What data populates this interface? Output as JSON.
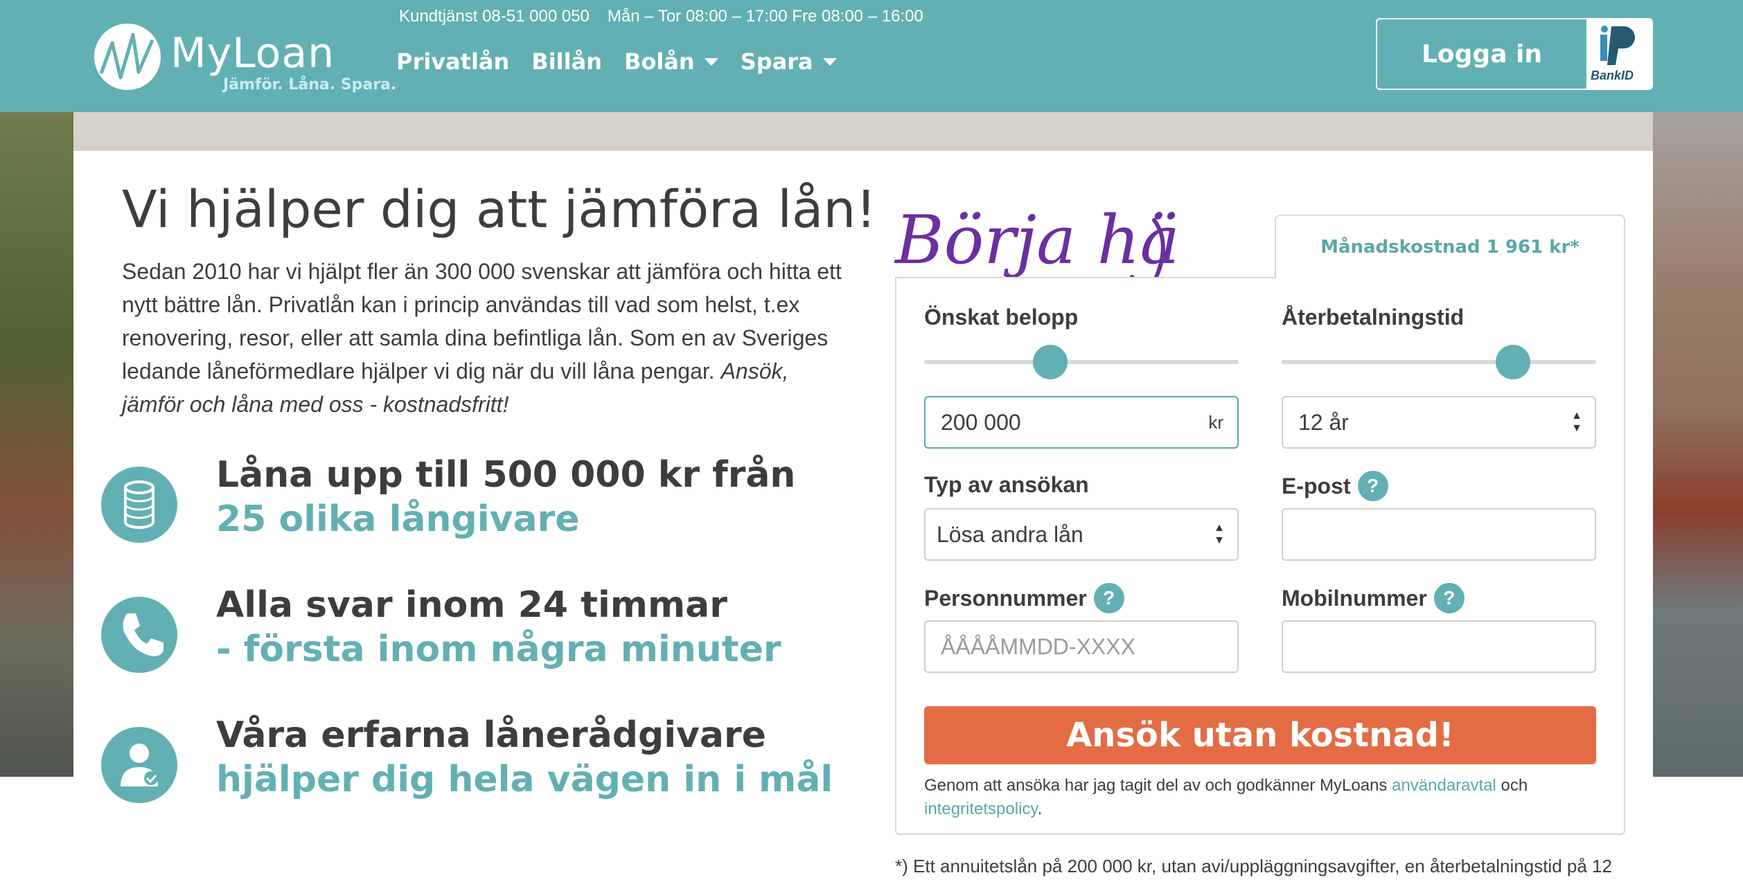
{
  "header": {
    "brand": "MyLoan",
    "tagline": "Jämför. Låna. Spara.",
    "support_phone": "Kundtjänst 08-51 000 050",
    "support_hours": "Mån – Tor 08:00 – 17:00 Fre 08:00 – 16:00",
    "nav": [
      {
        "label": "Privatlån",
        "dropdown": false
      },
      {
        "label": "Billån",
        "dropdown": false
      },
      {
        "label": "Bolån",
        "dropdown": true
      },
      {
        "label": "Spara",
        "dropdown": true
      }
    ],
    "login_label": "Logga in",
    "bankid_label": "BankID"
  },
  "hero": {
    "title": "Vi hjälper dig att jämföra lån!",
    "text": "Sedan 2010 har vi hjälpt fler än 300 000 svenskar att jämföra och hitta ett nytt bättre lån. Privatlån kan i princip användas till vad som helst, t.ex renovering, resor, eller att samla dina befintliga lån. Som en av Sveriges ledande låneförmedlare hjälper vi dig när du vill låna pengar.",
    "text_emphasis": "Ansök, jämför och låna med oss - kostnadsfritt!"
  },
  "features": [
    {
      "icon": "coins-icon",
      "line1": "Låna upp till 500 000 kr från",
      "line2": "25 olika långivare"
    },
    {
      "icon": "phone-icon",
      "line1": "Alla svar inom 24 timmar",
      "line2": "- första inom några minuter"
    },
    {
      "icon": "advisor-icon",
      "line1": "Våra erfarna lånerådgivare",
      "line2": "hjälper dig hela vägen in i mål"
    }
  ],
  "form": {
    "handwritten": "Börja här!",
    "monthly_cost_tab": "Månadskostnad 1 961 kr*",
    "amount_label": "Önskat belopp",
    "amount_value": "200 000",
    "amount_suffix": "kr",
    "amount_slider_fraction": 0.4,
    "term_label": "Återbetalningstid",
    "term_value": "12 år",
    "term_slider_fraction": 0.735,
    "type_label": "Typ av ansökan",
    "type_value": "Lösa andra lån",
    "email_label": "E-post",
    "email_value": "",
    "ssn_label": "Personnummer",
    "ssn_placeholder": "ÅÅÅÅMMDD-XXXX",
    "mobile_label": "Mobilnummer",
    "mobile_value": "",
    "help_glyph": "?",
    "submit_label": "Ansök utan kostnad!",
    "terms_prefix": "Genom att ansöka har jag tagit del av och godkänner MyLoans ",
    "terms_link1": "användaravtal",
    "terms_mid": " och ",
    "terms_link2": "integritetspolicy",
    "terms_suffix": "."
  },
  "footnote": "*) Ett annuitetslån på 200 000 kr, utan avi/uppläggningsavgifter, en återbetalningstid på 12",
  "colors": {
    "brand_teal": "#62b0b3",
    "cta_orange": "#e36c45",
    "handwriting_purple": "#6b2fa0",
    "text_dark": "#3d3d3d"
  }
}
